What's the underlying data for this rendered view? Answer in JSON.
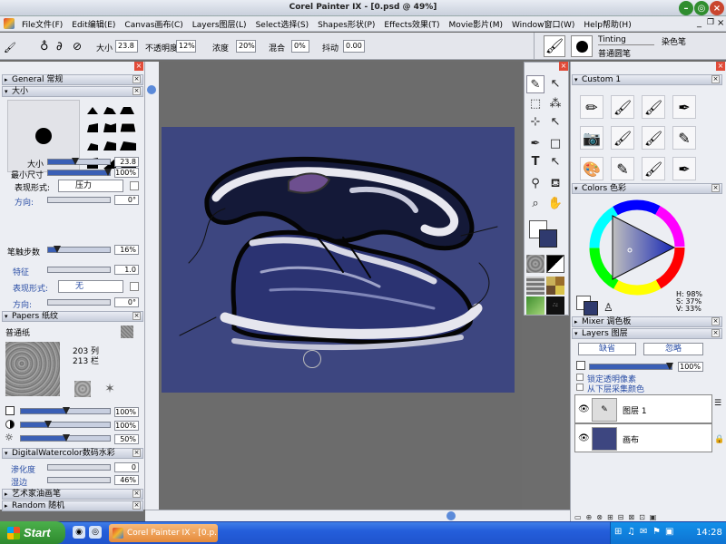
{
  "window": {
    "title": "Corel Painter IX - [0.psd @ 49%]"
  },
  "menu": [
    "File文件(F)",
    "Edit编辑(E)",
    "Canvas画布(C)",
    "Layers图层(L)",
    "Select选择(S)",
    "Shapes形状(P)",
    "Effects效果(T)",
    "Movie影片(M)",
    "Window窗口(W)",
    "Help帮助(H)"
  ],
  "propbar": {
    "size_label": "大小",
    "size_value": "23.8",
    "opacity_label": "不透明度",
    "opacity_value": "12%",
    "concentration_label": "浓度",
    "concentration_value": "20%",
    "blend_label": "混合",
    "blend_value": "0%",
    "jitter_label": "抖动",
    "jitter_value": "0.00",
    "brush_category": "Tinting",
    "brush_category_cn": "染色笔",
    "brush_variant": "普通圆笔"
  },
  "general_panel": {
    "title": "General 常规"
  },
  "size_panel": {
    "title": "大小",
    "size_label": "大小",
    "size_value": "23.8",
    "min_size_label": "最小尺寸",
    "min_size_value": "100%",
    "expression_label": "表现形式:",
    "expression_value": "压力",
    "direction_label": "方向:",
    "direction_value": "0°",
    "stroke_step_label": "笔触步数",
    "stroke_step_value": "16%",
    "feature_label": "特征",
    "feature_value": "1.0",
    "expression2_label": "表现形式:",
    "expression2_value": "无",
    "direction2_label": "方向:",
    "direction2_value": "0°"
  },
  "papers_panel": {
    "title": "Papers 纸纹",
    "paper_name": "普通纸",
    "cols": "203 列",
    "rows": "213 栏",
    "scale_value": "100%",
    "contrast_value": "100%",
    "brightness_value": "50%"
  },
  "watercolor_panel": {
    "title": "DigitalWatercolor数码水彩",
    "diffusion_label": "渗化度",
    "diffusion_value": "0",
    "wet_edge_label": "湿边",
    "wet_edge_value": "46%"
  },
  "collapsed_panels": [
    "艺术家油画笔",
    "Random 随机"
  ],
  "custom_panel": {
    "title": "Custom 1"
  },
  "colors_panel": {
    "title": "Colors 色彩",
    "h": "H: 98%",
    "s": "S: 37%",
    "v": "V: 33%",
    "main_color": "#2f3a6e",
    "secondary_color": "#ffffff"
  },
  "mixer_panel": {
    "title": "Mixer 调色板"
  },
  "layers_panel": {
    "title": "Layers 图层",
    "composite_method": "缺省",
    "composite_depth": "忽略",
    "opacity_value": "100%",
    "preserve_transparency": "锁定透明像素",
    "pick_up_color": "从下层采集颜色",
    "layers": [
      {
        "name": "图层 1"
      },
      {
        "name": "画布"
      }
    ]
  },
  "canvas": {
    "background": "#3d4680"
  },
  "taskbar": {
    "start": "Start",
    "app_button": "Corel Painter IX - [0.p...",
    "clock": "14:28"
  }
}
